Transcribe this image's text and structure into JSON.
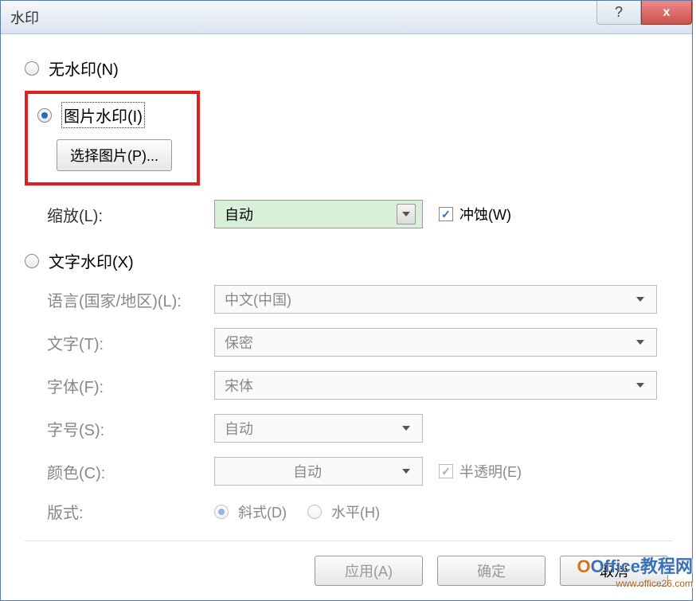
{
  "title": "水印",
  "no_watermark_label": "无水印(N)",
  "picture_watermark_label": "图片水印(I)",
  "select_picture_btn": "选择图片(P)...",
  "scale_label": "缩放(L):",
  "scale_value": "自动",
  "washout_label": "冲蚀(W)",
  "text_watermark_label": "文字水印(X)",
  "language_label": "语言(国家/地区)(L):",
  "language_value": "中文(中国)",
  "text_label": "文字(T):",
  "text_value": "保密",
  "font_label": "字体(F):",
  "font_value": "宋体",
  "size_label": "字号(S):",
  "size_value": "自动",
  "color_label": "颜色(C):",
  "color_value": "自动",
  "semitransparent_label": "半透明(E)",
  "layout_label": "版式:",
  "diagonal_label": "斜式(D)",
  "horizontal_label": "水平(H)",
  "apply_btn": "应用(A)",
  "ok_btn": "确定",
  "cancel_btn": "取消",
  "logo_main": "Office教程网",
  "logo_sub": "www.office26.com"
}
